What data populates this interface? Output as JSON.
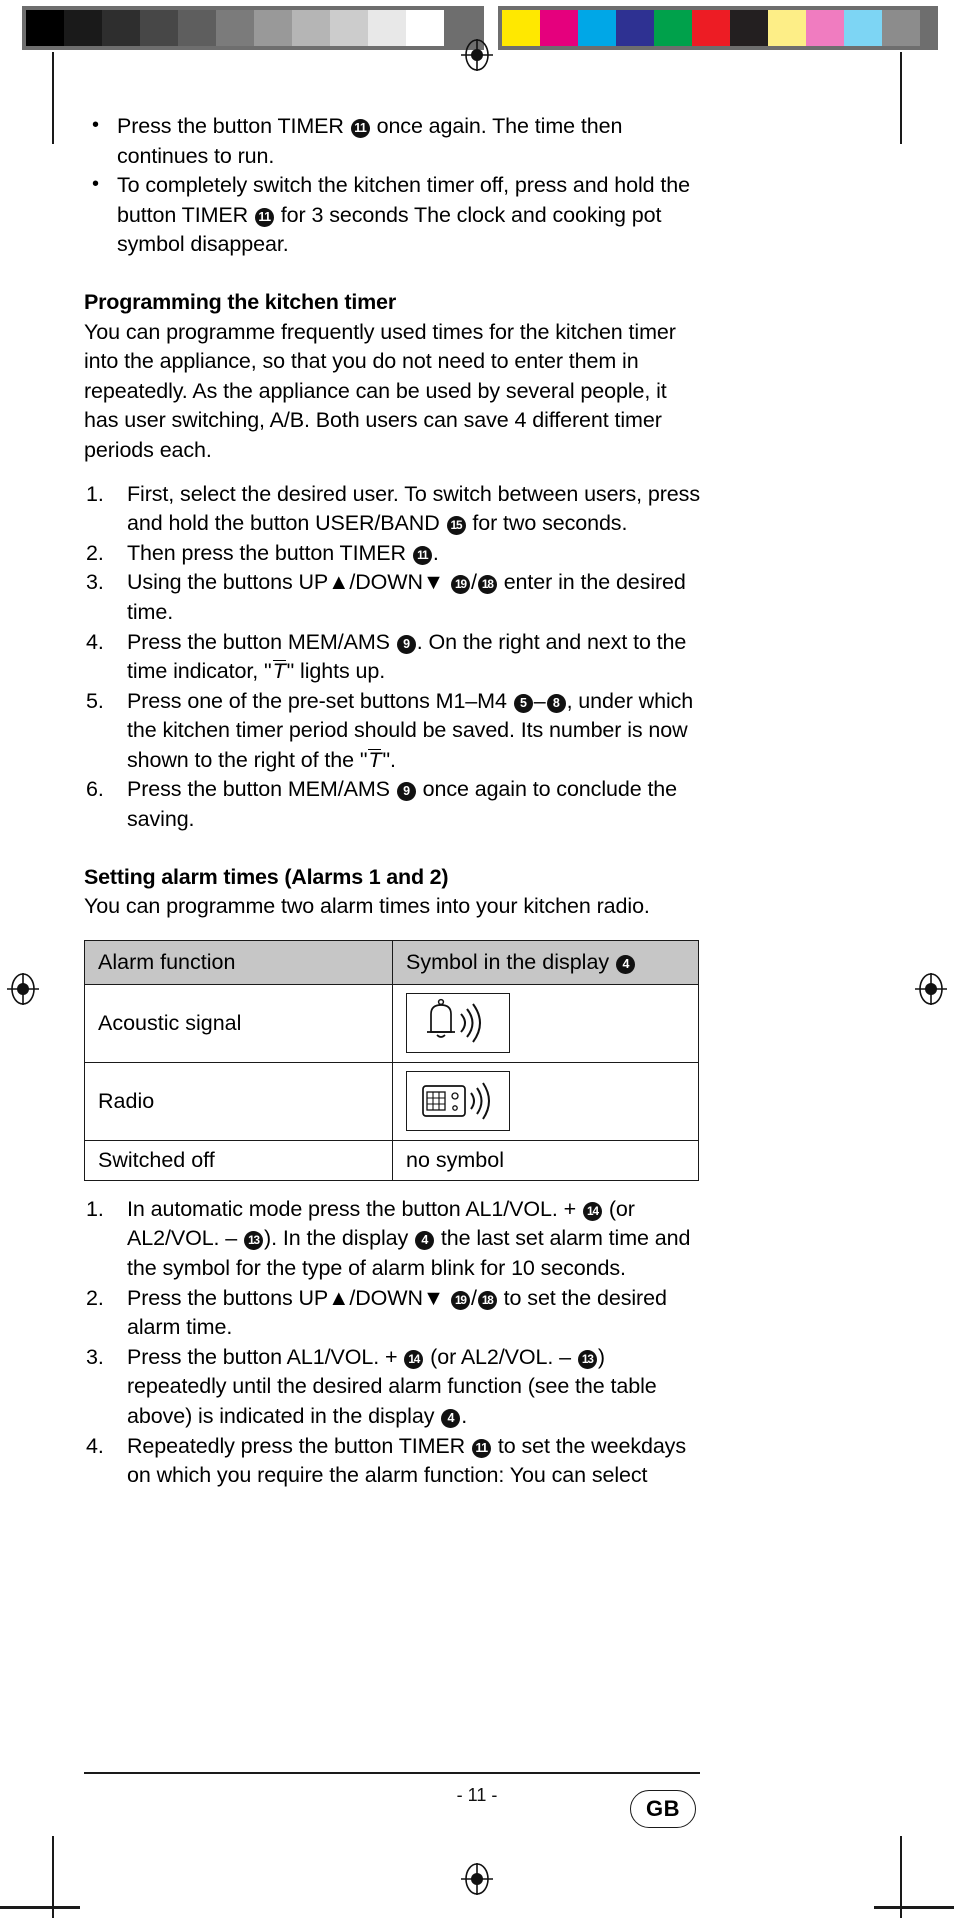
{
  "calibration": {
    "gray_swatches": [
      "#000000",
      "#1a1a1a",
      "#2e2e2e",
      "#474747",
      "#5e5e5e",
      "#7b7b7b",
      "#999999",
      "#b5b5b5",
      "#cccccc",
      "#e8e8e8",
      "#ffffff"
    ],
    "color_swatches": [
      "#ffe800",
      "#e5007d",
      "#00a7e7",
      "#2e3192",
      "#00a14b",
      "#ed1c24",
      "#231f20",
      "#fdee87",
      "#f07cc0",
      "#7dd5f4",
      "#8c8c8c"
    ]
  },
  "content": {
    "bullets": [
      "Press the button TIMER ➀ once again. The time then continues to run.",
      "To completely switch the kitchen timer off, press and hold the button TIMER ➀ for 3 seconds The clock and cooking pot symbol disappear."
    ],
    "bullet_1": {
      "pre": "Press the button TIMER ",
      "badge": "11",
      "post": " once again. The time then continues to run."
    },
    "bullet_2": {
      "pre": "To completely switch the kitchen timer off, press and hold the button TIMER ",
      "badge": "11",
      "post": " for 3 seconds The clock and cooking pot symbol disappear."
    },
    "heading_1": "Programming the kitchen timer",
    "intro_1": "You can programme frequently used times for the kitchen timer into the appliance, so that you do not need to enter them in repeatedly. As the appliance can be used by several people, it has user switching, A/B. Both users can save 4 different timer periods each.",
    "steps_1": [
      {
        "pre": "First, select the desired user. To switch between users, press and hold the button USER/BAND ",
        "badge_a": "15",
        "mid": " for two seconds.",
        "badge_b": "",
        "post": ""
      },
      {
        "pre": "Then press the button TIMER ",
        "badge_a": "11",
        "mid": ".",
        "badge_b": "",
        "post": ""
      },
      {
        "pre": "Using the buttons UP▲/DOWN▼ ",
        "badge_a": "19",
        "mid": "/",
        "badge_b": "18",
        "post": " enter in the desired time."
      },
      {
        "pre": "Press the button MEM/AMS ",
        "badge_a": "9",
        "mid": ". On the right and next to the time indicator, \"T\" lights up.",
        "badge_b": "",
        "post": ""
      },
      {
        "pre": "Press one of the pre-set buttons M1–M4 ",
        "badge_a": "5",
        "mid": "–",
        "badge_b": "8",
        "post": ", under which the kitchen timer period should be saved. Its number is now shown to the right of the \"T\"."
      },
      {
        "pre": "Press the button MEM/AMS ",
        "badge_a": "9",
        "mid": " once again to conclude the saving.",
        "badge_b": "",
        "post": ""
      }
    ],
    "heading_2": "Setting alarm times (Alarms 1 and 2)",
    "intro_2": "You can programme two alarm times into your kitchen radio.",
    "table": {
      "headers": [
        "Alarm function",
        "Symbol in the display "
      ],
      "header_2_badge": "4",
      "rows": [
        {
          "function": "Acoustic signal",
          "symbol_type": "bell-icon",
          "symbol_text": ""
        },
        {
          "function": "Radio",
          "symbol_type": "radio-icon",
          "symbol_text": ""
        },
        {
          "function": "Switched off",
          "symbol_type": "text",
          "symbol_text": "no symbol"
        }
      ]
    },
    "steps_2": [
      {
        "seg": [
          {
            "t": "In automatic mode press the button AL1/VOL. + "
          },
          {
            "b": "14"
          },
          {
            "t": " (or AL2/VOL. – "
          },
          {
            "b": "13"
          },
          {
            "t": "). In the display "
          },
          {
            "b": "4"
          },
          {
            "t": " the last set alarm time and the symbol for the type of alarm blink for 10 seconds."
          }
        ]
      },
      {
        "seg": [
          {
            "t": "Press the buttons UP▲/DOWN▼ "
          },
          {
            "b": "19"
          },
          {
            "t": "/"
          },
          {
            "b": "18"
          },
          {
            "t": " to set the desired alarm time."
          }
        ]
      },
      {
        "seg": [
          {
            "t": "Press the button AL1/VOL. + "
          },
          {
            "b": "14"
          },
          {
            "t": " (or AL2/VOL. – "
          },
          {
            "b": "13"
          },
          {
            "t": ") repeatedly until the desired alarm function (see the table above) is indicated in the display "
          },
          {
            "b": "4"
          },
          {
            "t": "."
          }
        ]
      },
      {
        "seg": [
          {
            "t": "Repeatedly press the button TIMER "
          },
          {
            "b": "11"
          },
          {
            "t": " to set the weekdays on which you require the alarm function: You can select"
          }
        ]
      }
    ]
  },
  "footer": {
    "page_number": "- 11 -",
    "language": "GB"
  }
}
